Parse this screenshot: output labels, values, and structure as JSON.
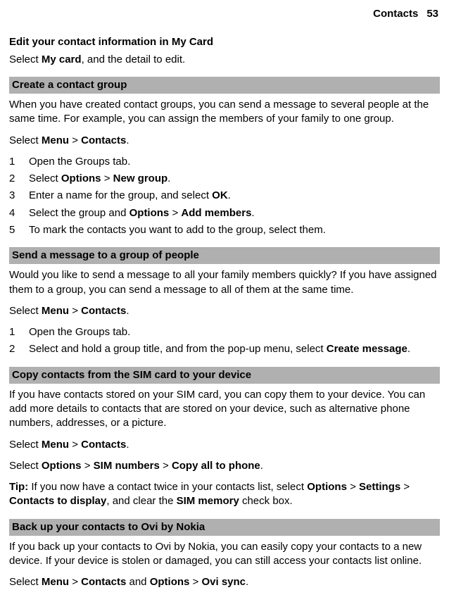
{
  "header": {
    "chapter": "Contacts",
    "page": "53"
  },
  "mycard": {
    "title": "Edit your contact information in My Card",
    "body_pre": "Select ",
    "body_bold": "My card",
    "body_post": ", and the detail to edit."
  },
  "group": {
    "bar": "Create a contact group",
    "intro": "When you have created contact groups, you can send a message to several people at the same time. For example, you can assign the members of your family to one group.",
    "sel_pre": "Select ",
    "sel_menu": "Menu",
    "sel_gt1": "  > ",
    "sel_contacts": "Contacts",
    "sel_post": ".",
    "steps": {
      "n1": "1",
      "t1": "Open the Groups tab.",
      "n2": "2",
      "t2_pre": "Select ",
      "t2_b1": "Options",
      "t2_gt": "  > ",
      "t2_b2": "New group",
      "t2_post": ".",
      "n3": "3",
      "t3_pre": "Enter a name for the group, and select ",
      "t3_b": "OK",
      "t3_post": ".",
      "n4": "4",
      "t4_pre": "Select the group and ",
      "t4_b1": "Options",
      "t4_gt": "  > ",
      "t4_b2": "Add members",
      "t4_post": ".",
      "n5": "5",
      "t5": "To mark the contacts you want to add to the group, select them."
    }
  },
  "send": {
    "bar": "Send a message to a group of people",
    "intro": "Would you like to send a message to all your family members quickly? If you have assigned them to a group, you can send a message to all of them at the same time.",
    "sel_pre": "Select ",
    "sel_menu": "Menu",
    "sel_gt": "  > ",
    "sel_contacts": "Contacts",
    "sel_post": ".",
    "steps": {
      "n1": "1",
      "t1": "Open the Groups tab.",
      "n2": "2",
      "t2_pre": "Select and hold a group title, and from the pop-up menu, select ",
      "t2_b": "Create message",
      "t2_post": "."
    }
  },
  "copy": {
    "bar": "Copy contacts from the SIM card to your device",
    "intro": "If you have contacts stored on your SIM card, you can copy them to your device. You can add more details to contacts that are stored on your device, such as alternative phone numbers, addresses, or a picture.",
    "sel_pre": "Select ",
    "sel_menu": "Menu",
    "sel_gt": "  > ",
    "sel_contacts": "Contacts",
    "sel_post": ".",
    "opt_pre": "Select ",
    "opt_b1": "Options",
    "opt_gt1": "  > ",
    "opt_b2": "SIM numbers",
    "opt_gt2": "  > ",
    "opt_b3": "Copy all to phone",
    "opt_post": ".",
    "tip_b": "Tip:",
    "tip_pre": " If you now have a contact twice in your contacts list, select ",
    "tip_b1": "Options",
    "tip_gt1": "  > ",
    "tip_b2": "Settings",
    "tip_gt2": "  > ",
    "tip_b3": "Contacts to display",
    "tip_mid": ", and clear the ",
    "tip_b4": "SIM memory",
    "tip_post": " check box."
  },
  "backup": {
    "bar": "Back up your contacts to Ovi by Nokia",
    "intro": "If you back up your contacts to Ovi by Nokia, you can easily copy your contacts to a new device. If your device is stolen or damaged, you can still access your contacts list online.",
    "sel_pre": "Select ",
    "sel_b1": "Menu",
    "sel_gt1": "  > ",
    "sel_b2": "Contacts",
    "sel_and": " and ",
    "sel_b3": "Options",
    "sel_gt2": "  > ",
    "sel_b4": "Ovi sync",
    "sel_post": "."
  }
}
